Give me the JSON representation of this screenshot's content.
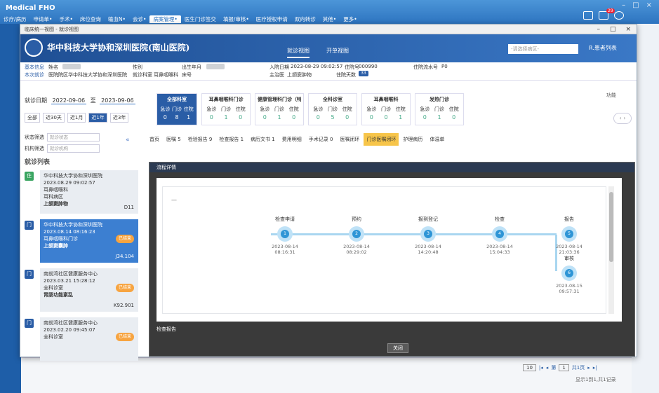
{
  "app": {
    "brand": "Medical FHO",
    "menu": [
      "诊疗/病历",
      "申请单•",
      "手术•",
      "床位查询",
      "输血N•",
      "会诊•",
      "病案管理•",
      "医生门诊签交",
      "填报/审核•",
      "医疗授权申请",
      "双向转诊",
      "其他•",
      "更多•"
    ],
    "active_menu_index": 6,
    "badge": "29"
  },
  "window": {
    "title": "临床统一视图 - 就诊视图"
  },
  "hospital": {
    "name": "华中科技大学协和深圳医院(南山医院)",
    "view_tabs": [
      "就诊视图",
      "开单视图"
    ],
    "active_view": 0,
    "search_placeholder": "-请选择病区-",
    "user": "R.患者列表"
  },
  "patient": {
    "base_label": "基本信息",
    "name_label": "姓名",
    "gender_label": "性别",
    "birth_label": "出生年月",
    "admit_label": "入院日期",
    "admit_value": "2023-08-29 09:02:57",
    "inpatient_no_label": "住院号",
    "inpatient_no_value": "000990",
    "card_label": "住院流水号",
    "card_value": "P0",
    "visit_label": "本次就诊",
    "ward_label": "医院院区",
    "ward_value": "华中科技大学协和深圳医院",
    "dept_label": "就诊科室",
    "dept_value": "耳鼻咽喉科",
    "bed_label": "床号",
    "doctor_label": "主治医",
    "doctor_value": "上颌窦肿物",
    "days_label": "住院天数",
    "days_value": "33"
  },
  "filter": {
    "date_label": "就诊日期",
    "date_from": "2022-09-06",
    "date_to": "2023-09-06",
    "to_label": "至",
    "quick": [
      "全部",
      "近30天",
      "近1月",
      "近1年",
      "近3年"
    ],
    "quick_active": 3,
    "status_label": "状态筛选",
    "status_placeholder": "就诊状态",
    "type_label": "机构筛选",
    "type_placeholder": "就诊机构",
    "list_title": "就诊列表"
  },
  "summary_cards": [
    {
      "title": "全部科室",
      "h": [
        "急诊",
        "门诊",
        "住院"
      ],
      "n": [
        "0",
        "8",
        "1"
      ]
    },
    {
      "title": "耳鼻咽喉科门诊",
      "h": [
        "急诊",
        "门诊",
        "住院"
      ],
      "n": [
        "0",
        "1",
        "0"
      ]
    },
    {
      "title": "健康管理科门诊（特",
      "h": [
        "急诊",
        "门诊",
        "住院"
      ],
      "n": [
        "0",
        "1",
        "0"
      ]
    },
    {
      "title": "全科诊室",
      "h": [
        "急诊",
        "门诊",
        "住院"
      ],
      "n": [
        "0",
        "5",
        "0"
      ]
    },
    {
      "title": "耳鼻咽喉科",
      "h": [
        "急诊",
        "门诊",
        "住院"
      ],
      "n": [
        "0",
        "0",
        "1"
      ]
    },
    {
      "title": "发热门诊",
      "h": [
        "急诊",
        "门诊",
        "住院"
      ],
      "n": [
        "0",
        "1",
        "0"
      ]
    }
  ],
  "cards_more": "功能",
  "visits": [
    {
      "icon": "住",
      "org": "华中科技大学协和深圳医院",
      "time": "2023.08.29 09:02:57",
      "dept": "耳鼻咽喉科",
      "ward": "耳科病区",
      "diag": "上颌窦肿物",
      "code": "D11",
      "tag": ""
    },
    {
      "icon": "门",
      "org": "华中科技大学协和深圳医院",
      "time": "2023.08.14 08:16:23",
      "dept": "耳鼻咽喉科门诊",
      "ward": "",
      "diag": "上颌窦囊肿",
      "code": "J34.104",
      "tag": "已结束"
    },
    {
      "icon": "门",
      "org": "南前湾社区健康服务中心",
      "time": "2023.03.21 15:28:12",
      "dept": "全科诊室",
      "ward": "",
      "diag": "胃肠功能紊乱",
      "code": "K92.901",
      "tag": "已结束"
    },
    {
      "icon": "门",
      "org": "南前湾社区健康服务中心",
      "time": "2023.02.20 09:45:07",
      "dept": "全科诊室",
      "ward": "",
      "diag": "",
      "code": "",
      "tag": "已结束"
    }
  ],
  "doc_tabs": [
    "首页",
    "医嘱 5",
    "检验报告 9",
    "检查报告 1",
    "病历文书 1",
    "费用明细",
    "手术记录 0",
    "医嘱闭环",
    "门诊医嘱闭环",
    "护理病历",
    "体温单"
  ],
  "doc_tab_active": 8,
  "modal": {
    "title": "流程详情",
    "steps": [
      {
        "n": "1",
        "label": "检查申请",
        "time": "2023-08-14 08:16:31"
      },
      {
        "n": "2",
        "label": "预约",
        "time": "2023-08-14 08:29:02"
      },
      {
        "n": "3",
        "label": "报到登记",
        "time": "2023-08-14 14:20:48"
      },
      {
        "n": "4",
        "label": "检查",
        "time": "2023-08-14 15:04:33"
      },
      {
        "n": "5",
        "label": "报告",
        "time": "2023-08-14 21:03:36"
      },
      {
        "n": "6",
        "label": "审核",
        "time": "2023-08-15 09:57:31"
      }
    ],
    "footer_label": "检查报告",
    "close": "关闭"
  },
  "pager": {
    "size": "10",
    "page_label": "第",
    "page": "1",
    "total": "共1页",
    "info": "显示1到1,共1记录"
  }
}
